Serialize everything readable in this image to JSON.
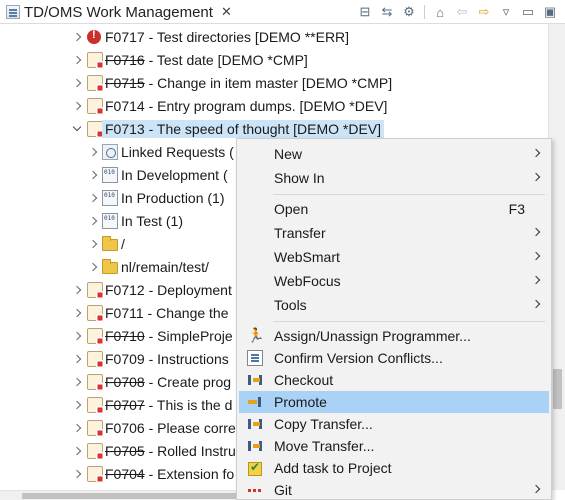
{
  "view": {
    "title": "TD/OMS Work Management",
    "close_glyph": "✕"
  },
  "toolbar": {
    "icons": [
      "collapse-all-icon",
      "link-with-editor-icon",
      "filter-gear-icon",
      "home-icon",
      "back-icon",
      "forward-icon",
      "view-menu-icon",
      "minimize-icon",
      "maximize-icon"
    ]
  },
  "tree": {
    "rows": [
      {
        "code": "F0717",
        "text": " - Test directories [DEMO **ERR]",
        "strike": false,
        "icon": "error-task-icon"
      },
      {
        "code": "F0716",
        "text": " - Test date [DEMO *CMP]",
        "strike": true,
        "icon": "task-icon"
      },
      {
        "code": "F0715",
        "text": " - Change in item master [DEMO *CMP]",
        "strike": true,
        "icon": "task-icon"
      },
      {
        "code": "F0714",
        "text": " - Entry program dumps. [DEMO *DEV]",
        "strike": false,
        "icon": "task-icon"
      },
      {
        "code": "F0713",
        "text": " - The speed of thought [DEMO *DEV]",
        "strike": false,
        "icon": "task-icon",
        "selected": true
      },
      {
        "code": "",
        "text": "Linked Requests (",
        "icon": "dependency-icon"
      },
      {
        "code": "",
        "text": "In Development (",
        "icon": "environment-icon"
      },
      {
        "code": "",
        "text": "In Production (1)",
        "icon": "environment-icon"
      },
      {
        "code": "",
        "text": "In Test (1)",
        "icon": "environment-icon"
      },
      {
        "code": "",
        "text": "/",
        "icon": "folder-icon"
      },
      {
        "code": "",
        "text": "nl/remain/test/",
        "icon": "folder-icon"
      },
      {
        "code": "F0712",
        "text": " - Deployment",
        "strike": false,
        "icon": "task-icon"
      },
      {
        "code": "F0711",
        "text": " - Change the",
        "strike": false,
        "icon": "task-icon"
      },
      {
        "code": "F0710",
        "text": " - SimpleProje",
        "strike": true,
        "icon": "task-icon"
      },
      {
        "code": "F0709",
        "text": " - Instructions",
        "strike": false,
        "icon": "task-icon"
      },
      {
        "code": "F0708",
        "text": " - Create prog",
        "strike": true,
        "icon": "task-icon"
      },
      {
        "code": "F0707",
        "text": " - This is the d",
        "strike": true,
        "icon": "task-icon"
      },
      {
        "code": "F0706",
        "text": " - Please corre",
        "strike": false,
        "icon": "task-icon"
      },
      {
        "code": "F0705",
        "text": " - Rolled Instru",
        "strike": true,
        "icon": "task-icon"
      },
      {
        "code": "F0704",
        "text": " - Extension fo",
        "strike": true,
        "icon": "task-icon"
      }
    ]
  },
  "context_menu": {
    "items": [
      {
        "label": "New",
        "submenu": true
      },
      {
        "label": "Show In",
        "submenu": true
      },
      {
        "label": "Open",
        "accel": "F3"
      },
      {
        "label": "Transfer",
        "submenu": true
      },
      {
        "label": "WebSmart",
        "submenu": true
      },
      {
        "label": "WebFocus",
        "submenu": true
      },
      {
        "label": "Tools",
        "submenu": true
      },
      {
        "label": "Assign/Unassign Programmer...",
        "icon": "programmer-runner-icon"
      },
      {
        "label": "Confirm Version Conflicts...",
        "icon": "document-list-icon"
      },
      {
        "label": "Checkout",
        "icon": "checkout-transfer-icon"
      },
      {
        "label": "Promote",
        "icon": "promote-arrow-icon",
        "highlighted": true
      },
      {
        "label": "Copy Transfer...",
        "icon": "copy-transfer-icon"
      },
      {
        "label": "Move Transfer...",
        "icon": "move-transfer-icon"
      },
      {
        "label": "Add task to Project",
        "icon": "add-task-project-icon"
      },
      {
        "label": "Git",
        "icon": "git-icon",
        "submenu": true
      }
    ]
  },
  "colors": {
    "selection": "#cce4f7",
    "menu_highlight": "#a9d2f6",
    "menu_bg": "#f2f2f2",
    "error_red": "#c9302c"
  }
}
